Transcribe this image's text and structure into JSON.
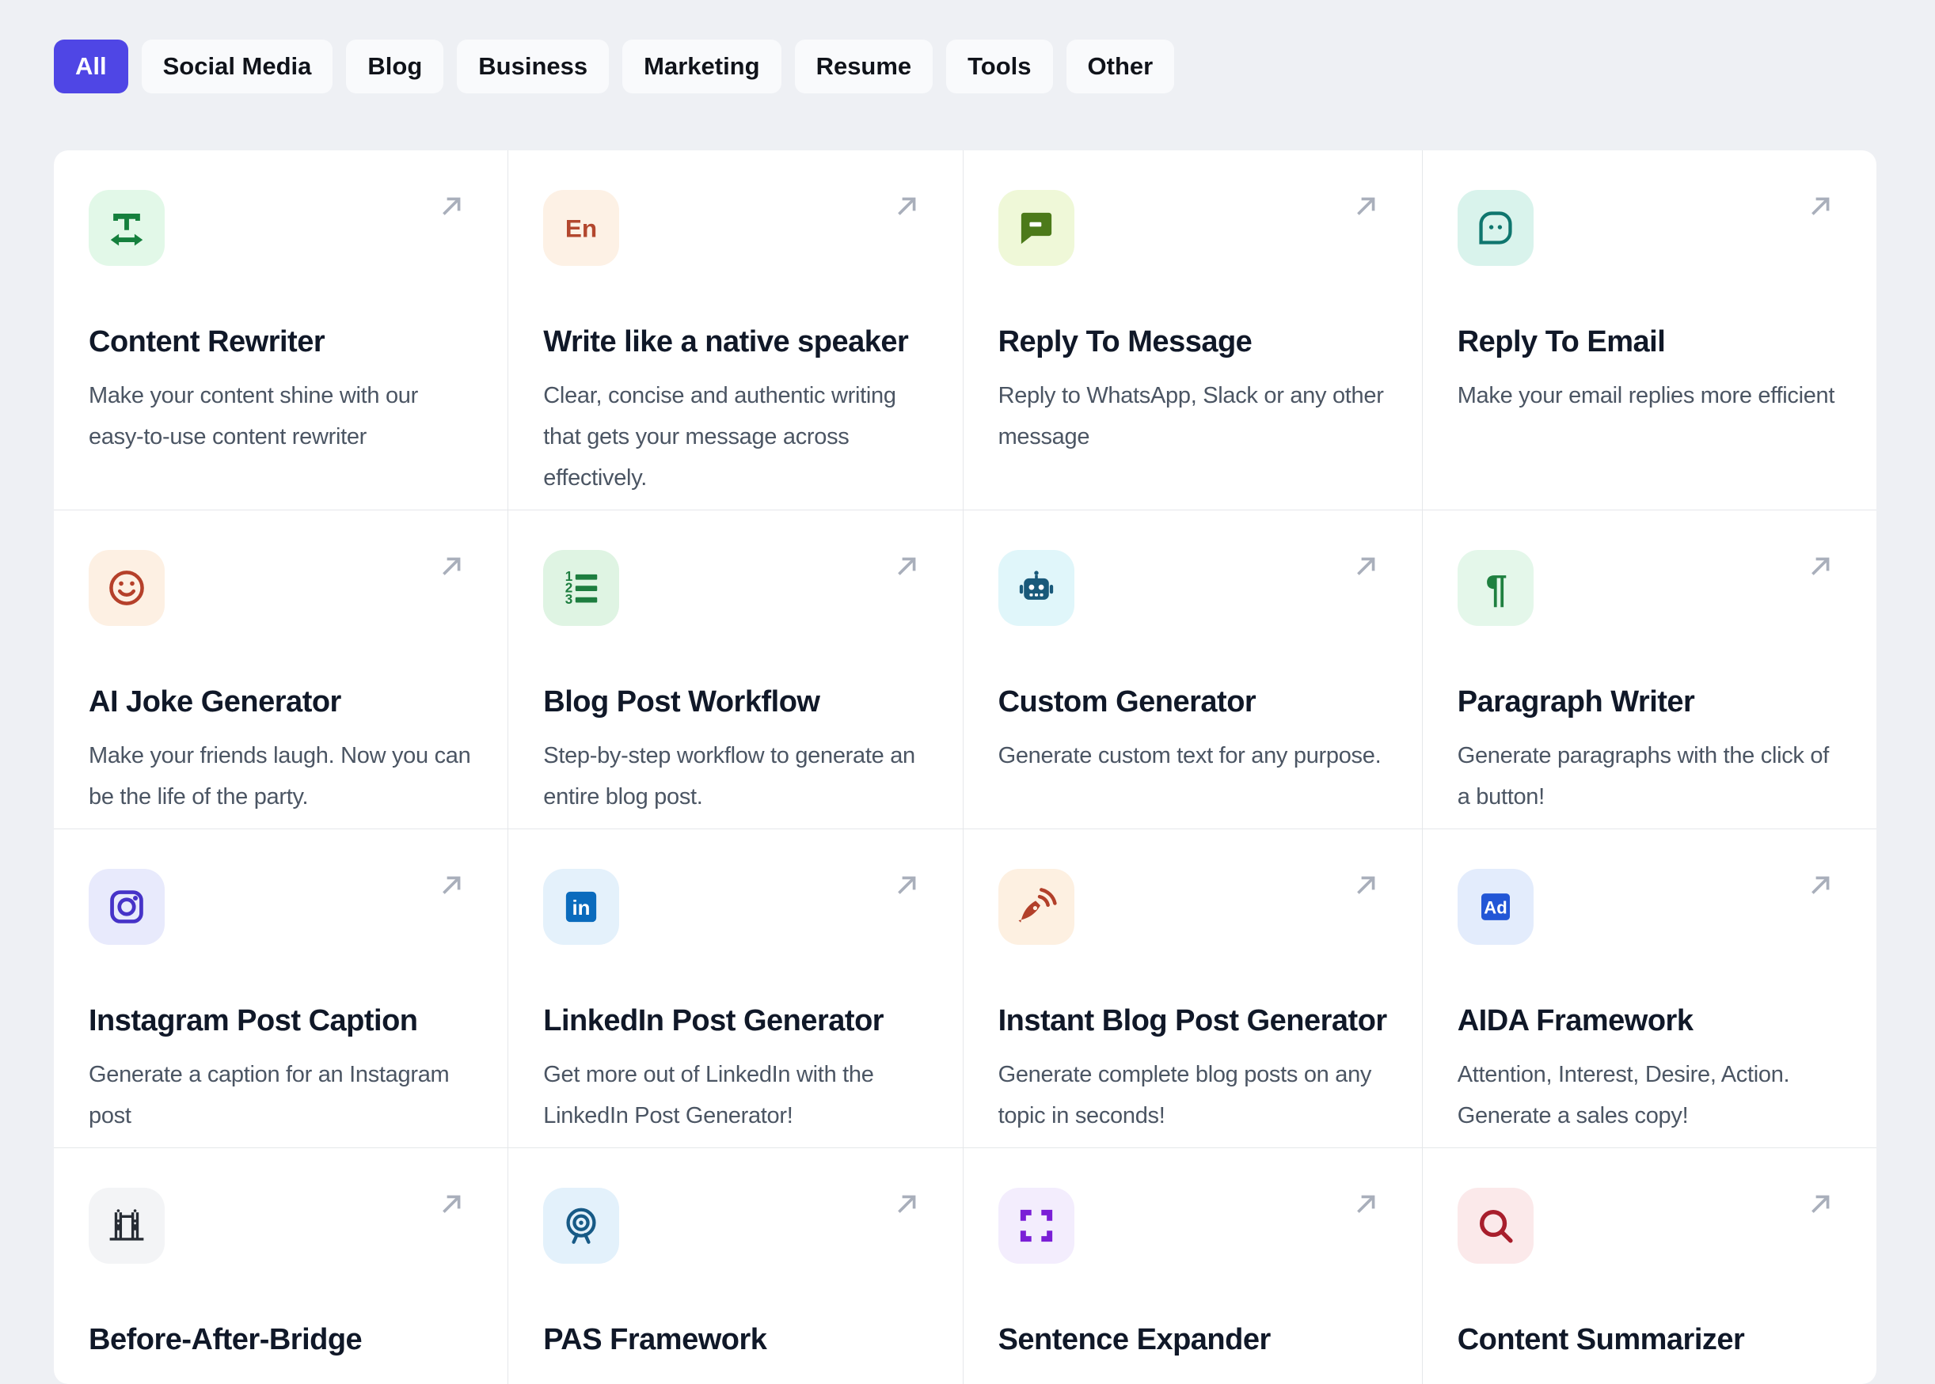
{
  "page": {
    "background_color": "#eef0f4",
    "card_background": "#ffffff",
    "divider_color": "#e5e7ea",
    "title_color": "#101828",
    "description_color": "#4b5563",
    "arrow_color": "#a9afbb",
    "active_tab_color": "#4f46e5"
  },
  "tabs": [
    {
      "label": "All",
      "active": true
    },
    {
      "label": "Social Media",
      "active": false
    },
    {
      "label": "Blog",
      "active": false
    },
    {
      "label": "Business",
      "active": false
    },
    {
      "label": "Marketing",
      "active": false
    },
    {
      "label": "Resume",
      "active": false
    },
    {
      "label": "Tools",
      "active": false
    },
    {
      "label": "Other",
      "active": false
    }
  ],
  "cards": [
    {
      "title": "Content Rewriter",
      "description": "Make your content shine with our easy-to-use content rewriter",
      "icon": "text-width-icon",
      "icon_bg": "#e2f8e8",
      "icon_fg": "#15803d"
    },
    {
      "title": "Write like a native speaker",
      "description": "Clear, concise and authentic writing that gets your message across effectively.",
      "icon": "english-letters-icon",
      "icon_bg": "#fdf1e5",
      "icon_fg": "#b3472e"
    },
    {
      "title": "Reply To Message",
      "description": "Reply to WhatsApp, Slack or any other message",
      "icon": "chat-bubble-minus-icon",
      "icon_bg": "#eff8d8",
      "icon_fg": "#4c7a1a"
    },
    {
      "title": "Reply To Email",
      "description": "Make your email replies more efficient",
      "icon": "bubble-dots-icon",
      "icon_bg": "#d9f3ec",
      "icon_fg": "#0f766e"
    },
    {
      "title": "AI Joke Generator",
      "description": "Make your friends laugh. Now you can be the life of the party.",
      "icon": "smiley-icon",
      "icon_bg": "#fdf0e3",
      "icon_fg": "#b5402a"
    },
    {
      "title": "Blog Post Workflow",
      "description": "Step-by-step workflow to generate an entire blog post.",
      "icon": "numbered-list-icon",
      "icon_bg": "#dff4e3",
      "icon_fg": "#1d7d3f"
    },
    {
      "title": "Custom Generator",
      "description": "Generate custom text for any purpose.",
      "icon": "robot-icon",
      "icon_bg": "#e0f6fa",
      "icon_fg": "#19597a"
    },
    {
      "title": "Paragraph Writer",
      "description": "Generate paragraphs with the click of a button!",
      "icon": "pilcrow-icon",
      "icon_bg": "#e4f7ea",
      "icon_fg": "#1f8040"
    },
    {
      "title": "Instagram Post Caption",
      "description": "Generate a caption for an Instagram post",
      "icon": "instagram-icon",
      "icon_bg": "#e8eafc",
      "icon_fg": "#4633c8"
    },
    {
      "title": "LinkedIn Post Generator",
      "description": "Get more out of LinkedIn with the LinkedIn Post Generator!",
      "icon": "linkedin-icon",
      "icon_bg": "#e4f1fb",
      "icon_fg": "#0a6bbd"
    },
    {
      "title": "Instant Blog Post Generator",
      "description": "Generate complete blog posts on any topic in seconds!",
      "icon": "pen-signal-icon",
      "icon_bg": "#fdf0e1",
      "icon_fg": "#b2402a"
    },
    {
      "title": "AIDA Framework",
      "description": "Attention, Interest, Desire, Action. Generate a sales copy!",
      "icon": "ad-badge-icon",
      "icon_bg": "#e3ecfc",
      "icon_fg": "#2256d6"
    },
    {
      "title": "Before-After-Bridge",
      "description": "",
      "icon": "bridge-icon",
      "icon_bg": "#f3f4f6",
      "icon_fg": "#272c34"
    },
    {
      "title": "PAS Framework",
      "description": "",
      "icon": "target-icon",
      "icon_bg": "#e3f1fb",
      "icon_fg": "#175a86"
    },
    {
      "title": "Sentence Expander",
      "description": "",
      "icon": "expand-corners-icon",
      "icon_bg": "#f3edfd",
      "icon_fg": "#7a1fd6"
    },
    {
      "title": "Content Summarizer",
      "description": "",
      "icon": "magnifier-icon",
      "icon_bg": "#fbe9ea",
      "icon_fg": "#a81e2c"
    }
  ]
}
